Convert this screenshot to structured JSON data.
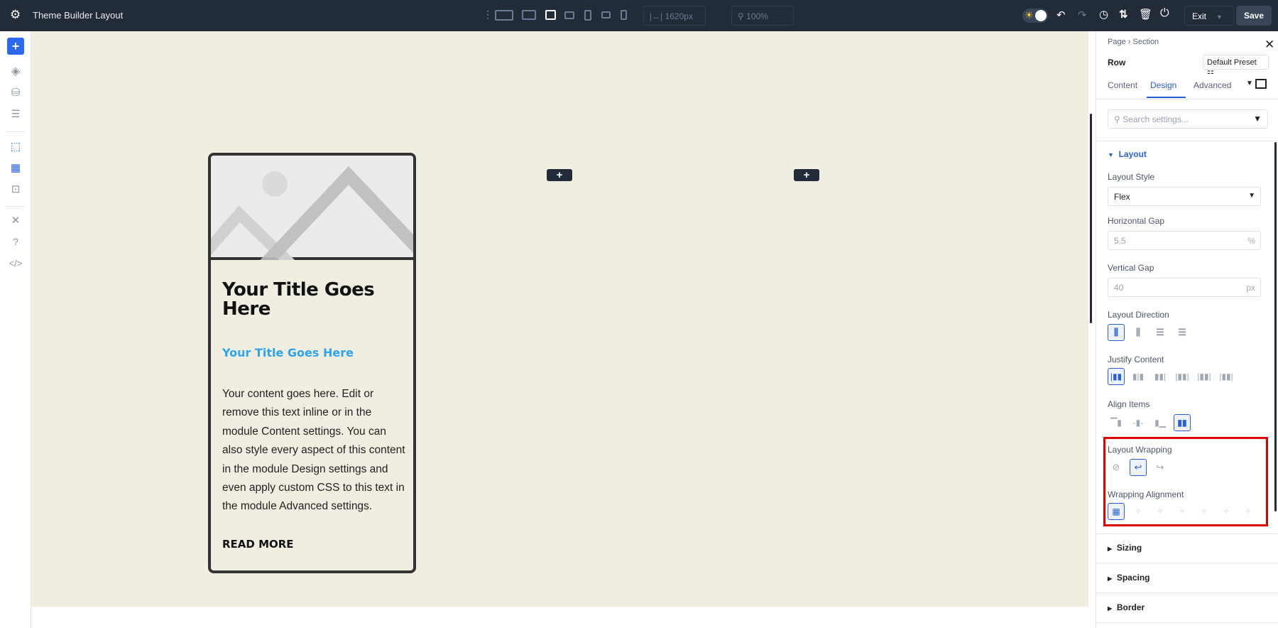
{
  "topbar": {
    "title": "Theme Builder Layout",
    "width_value": "1620px",
    "zoom_value": "100%",
    "exit_label": "Exit",
    "save_label": "Save"
  },
  "card": {
    "title": "Your Title Goes Here",
    "subtitle": "Your Title Goes Here",
    "body": "Your content goes here. Edit or remove this text inline or in the module Content settings. You can also style every aspect of this content in the module Design settings and even apply custom CSS to this text in the module Advanced settings.",
    "read_more": "READ MORE"
  },
  "canvas": {
    "add_label": "+"
  },
  "panel": {
    "breadcrumb": [
      "Page",
      "Section"
    ],
    "element": "Row",
    "preset": "Default Preset",
    "tabs": [
      "Content",
      "Design",
      "Advanced"
    ],
    "active_tab": "Design",
    "search_placeholder": "Search settings...",
    "layout_section": "Layout",
    "layout_style_label": "Layout Style",
    "layout_style_value": "Flex",
    "hgap_label": "Horizontal Gap",
    "hgap_value": "5.5",
    "hgap_unit": "%",
    "vgap_label": "Vertical Gap",
    "vgap_value": "40",
    "vgap_unit": "px",
    "direction_label": "Layout Direction",
    "justify_label": "Justify Content",
    "align_label": "Align Items",
    "wrap_label": "Layout Wrapping",
    "wrap_align_label": "Wrapping Alignment",
    "sections": [
      "Sizing",
      "Spacing",
      "Border"
    ]
  },
  "colors": {
    "accent": "#2b5fd9",
    "highlight": "#e00000",
    "canvas": "#f0ede1",
    "topbar": "#222b38"
  }
}
